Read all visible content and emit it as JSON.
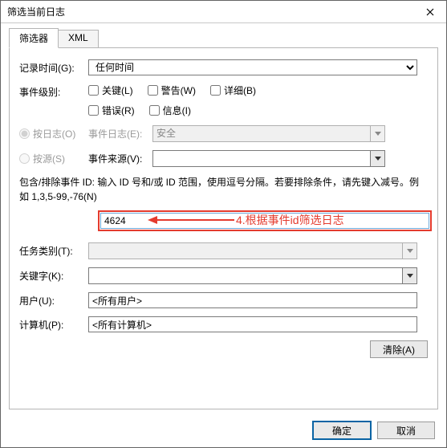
{
  "title": "筛选当前日志",
  "tabs": {
    "filter": "筛选器",
    "xml": "XML"
  },
  "labels": {
    "logged": "记录时间(G):",
    "level": "事件级别:",
    "bylog": "按日志(O)",
    "bysource": "按源(S)",
    "eventlog": "事件日志(E):",
    "eventsource": "事件来源(V):",
    "task": "任务类别(T):",
    "keywords": "关键字(K):",
    "user": "用户(U):",
    "computer": "计算机(P):"
  },
  "logged_value": "任何时间",
  "level": {
    "critical": "关键(L)",
    "warning": "警告(W)",
    "verbose": "详细(B)",
    "error": "错误(R)",
    "info": "信息(I)"
  },
  "eventlog_value": "安全",
  "eventsource_value": "",
  "id_help": "包含/排除事件 ID: 输入 ID 号和/或 ID 范围，使用逗号分隔。若要排除条件，请先键入减号。例如 1,3,5-99,-76(N)",
  "id_value": "4624",
  "annotation": "4.根据事件id筛选日志",
  "task_value": "",
  "keywords_value": "",
  "user_value": "<所有用户>",
  "computer_value": "<所有计算机>",
  "buttons": {
    "clear": "清除(A)",
    "ok": "确定",
    "cancel": "取消"
  }
}
